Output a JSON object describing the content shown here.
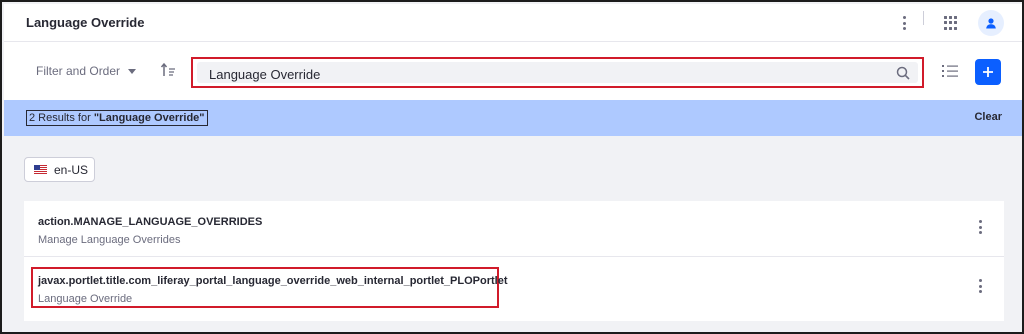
{
  "header": {
    "title": "Language Override",
    "icons": [
      "vertical-ellipsis-icon",
      "apps-grid-icon",
      "user-avatar-icon"
    ]
  },
  "toolbar": {
    "filter_label": "Filter and Order",
    "search_value": "Language Override",
    "icons": [
      "sort-icon",
      "search-icon",
      "list-view-icon",
      "plus-icon"
    ]
  },
  "results": {
    "prefix": "2 Results for ",
    "query": "\"Language Override\"",
    "clear_label": "Clear"
  },
  "locale": {
    "label": "en-US",
    "icon": "us-flag-icon"
  },
  "items": [
    {
      "key": "action.MANAGE_LANGUAGE_OVERRIDES",
      "value": "Manage Language Overrides"
    },
    {
      "key": "javax.portlet.title.com_liferay_portal_language_override_web_internal_portlet_PLOPortlet",
      "value": "Language Override"
    }
  ],
  "colors": {
    "accent": "#0b5fff",
    "results_bar": "#aec9ff",
    "highlight": "#d11b2a"
  }
}
